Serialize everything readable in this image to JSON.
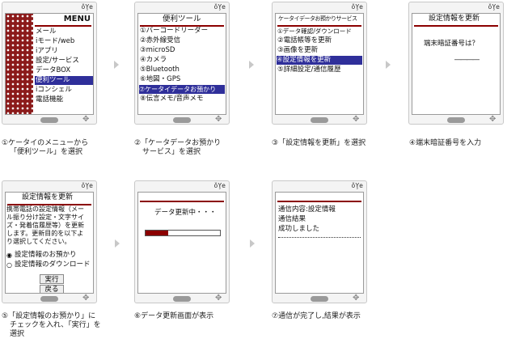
{
  "status_icons": "ǒ̧Ye",
  "steps": [
    {
      "menu_title": "MENU",
      "menu_items": [
        "メール",
        "iモード/web",
        "iアプリ",
        "設定/サービス",
        "データBOX",
        "便利ツール",
        "iコンシェル",
        "電話機能"
      ],
      "selected_index": 5,
      "caption": [
        "①ケータイのメニューから",
        "「便利ツール」を選択"
      ]
    },
    {
      "title": "便利ツール",
      "items": [
        "①バーコードリーダー",
        "②赤外線受信",
        "③microSD",
        "④カメラ",
        "⑤Bluetooth",
        "⑥地図・GPS",
        "⑦ケータイデータお預かり",
        "⑧伝言メモ/音声メモ"
      ],
      "selected_index": 6,
      "caption": [
        "②「ケータデータお預かり",
        "サービス」を選択"
      ]
    },
    {
      "title": "ケータイデータお預かりサービス",
      "items": [
        "①データ確認/ダウンロード",
        "②電話帳等を更新",
        "③画像を更新",
        "④設定情報を更新",
        "⑤詳細設定/通信履歴"
      ],
      "selected_index": 3,
      "caption": [
        "③「設定情報を更新」を選択"
      ]
    },
    {
      "title": "設定情報を更新",
      "prompt": "端末暗証番号は？",
      "input_mask": "――――",
      "caption": [
        "④端末暗証番号を入力"
      ]
    },
    {
      "title": "設定情報を更新",
      "body": [
        "携帯電話の設定情報（メー",
        "ル振り分け設定・文字サイ",
        "ズ・発着信履歴等）を更新",
        "します。更新目的を以下よ",
        "り選択してください。"
      ],
      "options": [
        "設定情報のお預かり",
        "設定情報のダウンロード"
      ],
      "selected_option": 0,
      "exec_label": "実行",
      "back_label": "戻る",
      "caption": [
        "⑤「設定情報のお預かり」に",
        "チェックを入れ、「実行」を",
        "選択"
      ]
    },
    {
      "message": "データ更新中・・・",
      "progress": 0.3,
      "caption": [
        "⑥データ更新画面が表示"
      ]
    },
    {
      "result_lines": [
        "通信内容:設定情報",
        "通信結果",
        "成功しました"
      ],
      "caption": [
        "⑦通信が完了し,結果が表示"
      ]
    }
  ]
}
